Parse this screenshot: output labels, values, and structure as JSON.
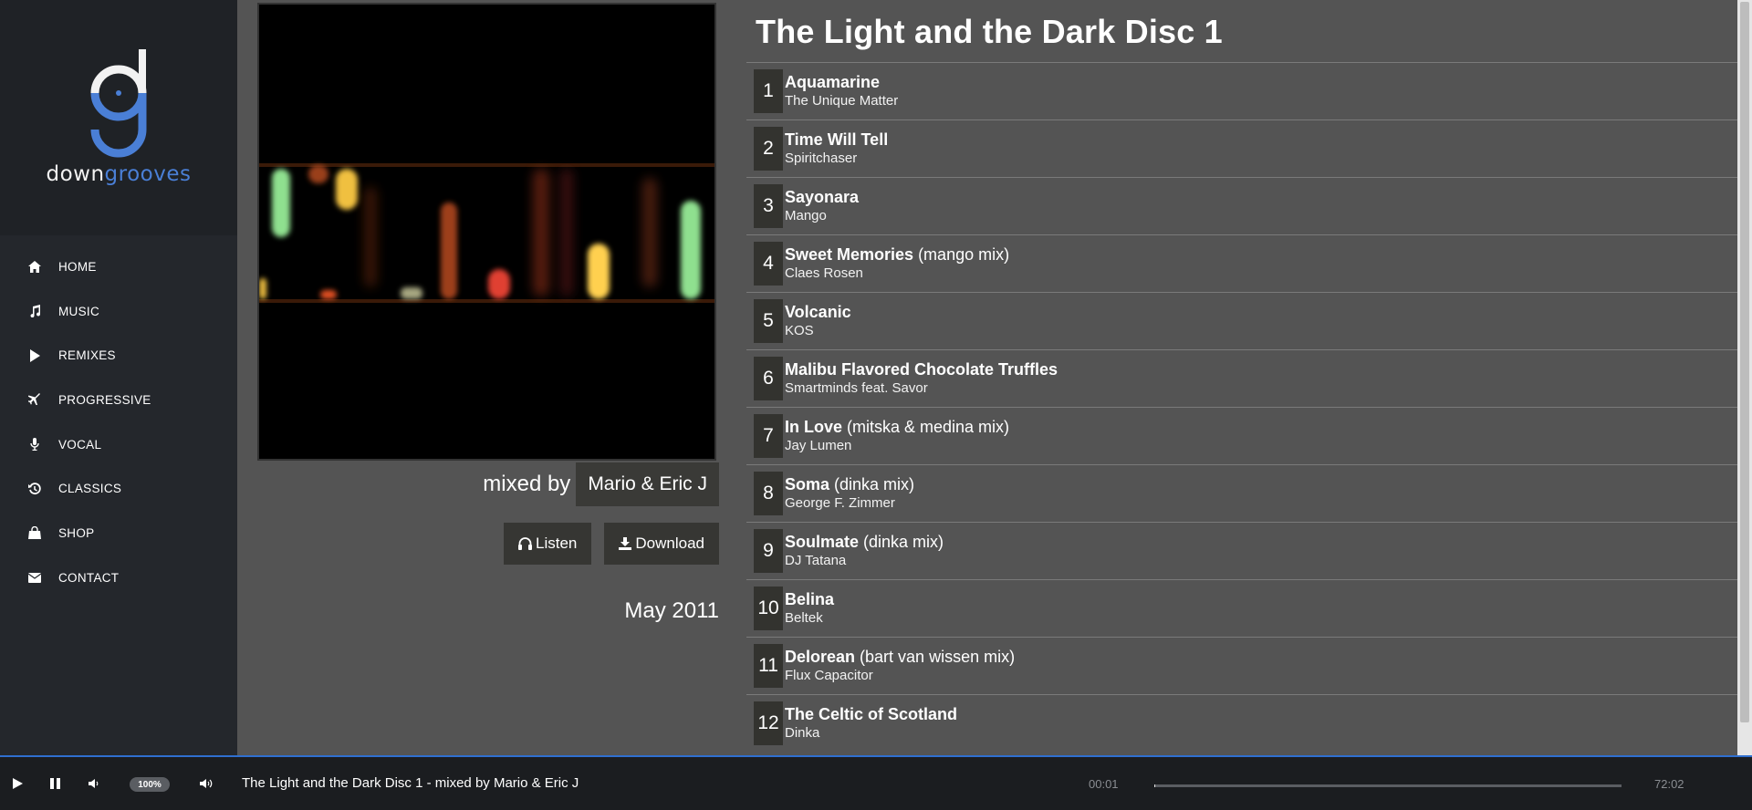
{
  "sidebar": {
    "brand_part1": "down",
    "brand_part2": "grooves",
    "items": [
      {
        "label": "HOME",
        "icon": "home-icon"
      },
      {
        "label": "MUSIC",
        "icon": "music-note-icon"
      },
      {
        "label": "REMIXES",
        "icon": "play-icon"
      },
      {
        "label": "PROGRESSIVE",
        "icon": "plane-icon"
      },
      {
        "label": "VOCAL",
        "icon": "microphone-icon"
      },
      {
        "label": "CLASSICS",
        "icon": "history-icon"
      },
      {
        "label": "SHOP",
        "icon": "shopping-bag-icon"
      },
      {
        "label": "CONTACT",
        "icon": "envelope-icon"
      }
    ]
  },
  "album": {
    "mixed_by_label": "mixed by",
    "mixed_by_name": "Mario & Eric J",
    "listen_label": "Listen",
    "download_label": "Download",
    "date": "May 2011"
  },
  "main": {
    "title": "The Light and the Dark Disc 1",
    "tracks": [
      {
        "num": "1",
        "title": "Aquamarine",
        "mix": "",
        "artist": "The Unique Matter"
      },
      {
        "num": "2",
        "title": "Time Will Tell",
        "mix": "",
        "artist": "Spiritchaser"
      },
      {
        "num": "3",
        "title": "Sayonara",
        "mix": "",
        "artist": "Mango"
      },
      {
        "num": "4",
        "title": "Sweet Memories",
        "mix": " (mango mix)",
        "artist": "Claes Rosen"
      },
      {
        "num": "5",
        "title": "Volcanic",
        "mix": "",
        "artist": "KOS"
      },
      {
        "num": "6",
        "title": "Malibu Flavored Chocolate Truffles",
        "mix": "",
        "artist": "Smartminds feat. Savor"
      },
      {
        "num": "7",
        "title": "In Love",
        "mix": " (mitska & medina mix)",
        "artist": "Jay Lumen"
      },
      {
        "num": "8",
        "title": "Soma",
        "mix": " (dinka mix)",
        "artist": "George F. Zimmer"
      },
      {
        "num": "9",
        "title": "Soulmate",
        "mix": " (dinka mix)",
        "artist": "DJ Tatana"
      },
      {
        "num": "10",
        "title": "Belina",
        "mix": "",
        "artist": "Beltek"
      },
      {
        "num": "11",
        "title": "Delorean",
        "mix": " (bart van wissen mix)",
        "artist": "Flux Capacitor"
      },
      {
        "num": "12",
        "title": "The Celtic of Scotland",
        "mix": "",
        "artist": "Dinka"
      }
    ]
  },
  "player": {
    "volume": "100%",
    "now_playing": "The Light and the Dark Disc 1 - mixed by Mario & Eric J",
    "current_time": "00:01",
    "total_time": "72:02",
    "progress_fraction": 0.0002
  },
  "colors": {
    "accent": "#4a7fd6",
    "sidebar_bg": "#24272c",
    "main_bg": "#545454",
    "player_bg": "#1b1d20"
  }
}
